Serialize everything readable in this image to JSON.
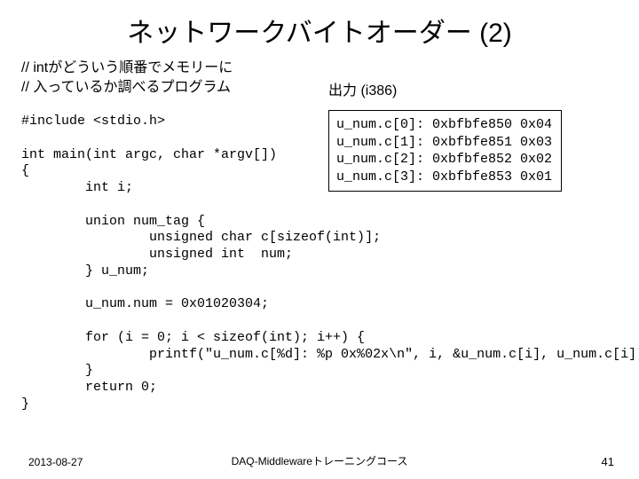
{
  "title": "ネットワークバイトオーダー (2)",
  "comment_l1": "// intがどういう順番でメモリーに",
  "comment_l2": "// 入っているか調べるプログラム",
  "output_label": "出力 (i386)",
  "output_lines": "u_num.c[0]: 0xbfbfe850 0x04\nu_num.c[1]: 0xbfbfe851 0x03\nu_num.c[2]: 0xbfbfe852 0x02\nu_num.c[3]: 0xbfbfe853 0x01",
  "code": "#include <stdio.h>\n\nint main(int argc, char *argv[])\n{\n        int i;\n\n        union num_tag {\n                unsigned char c[sizeof(int)];\n                unsigned int  num;\n        } u_num;\n\n        u_num.num = 0x01020304;\n\n        for (i = 0; i < sizeof(int); i++) {\n                printf(\"u_num.c[%d]: %p 0x%02x\\n\", i, &u_num.c[i], u_num.c[i]);\n        }\n        return 0;\n}",
  "date": "2013-08-27",
  "course": "DAQ-Middlewareトレーニングコース",
  "pagenum": "41"
}
